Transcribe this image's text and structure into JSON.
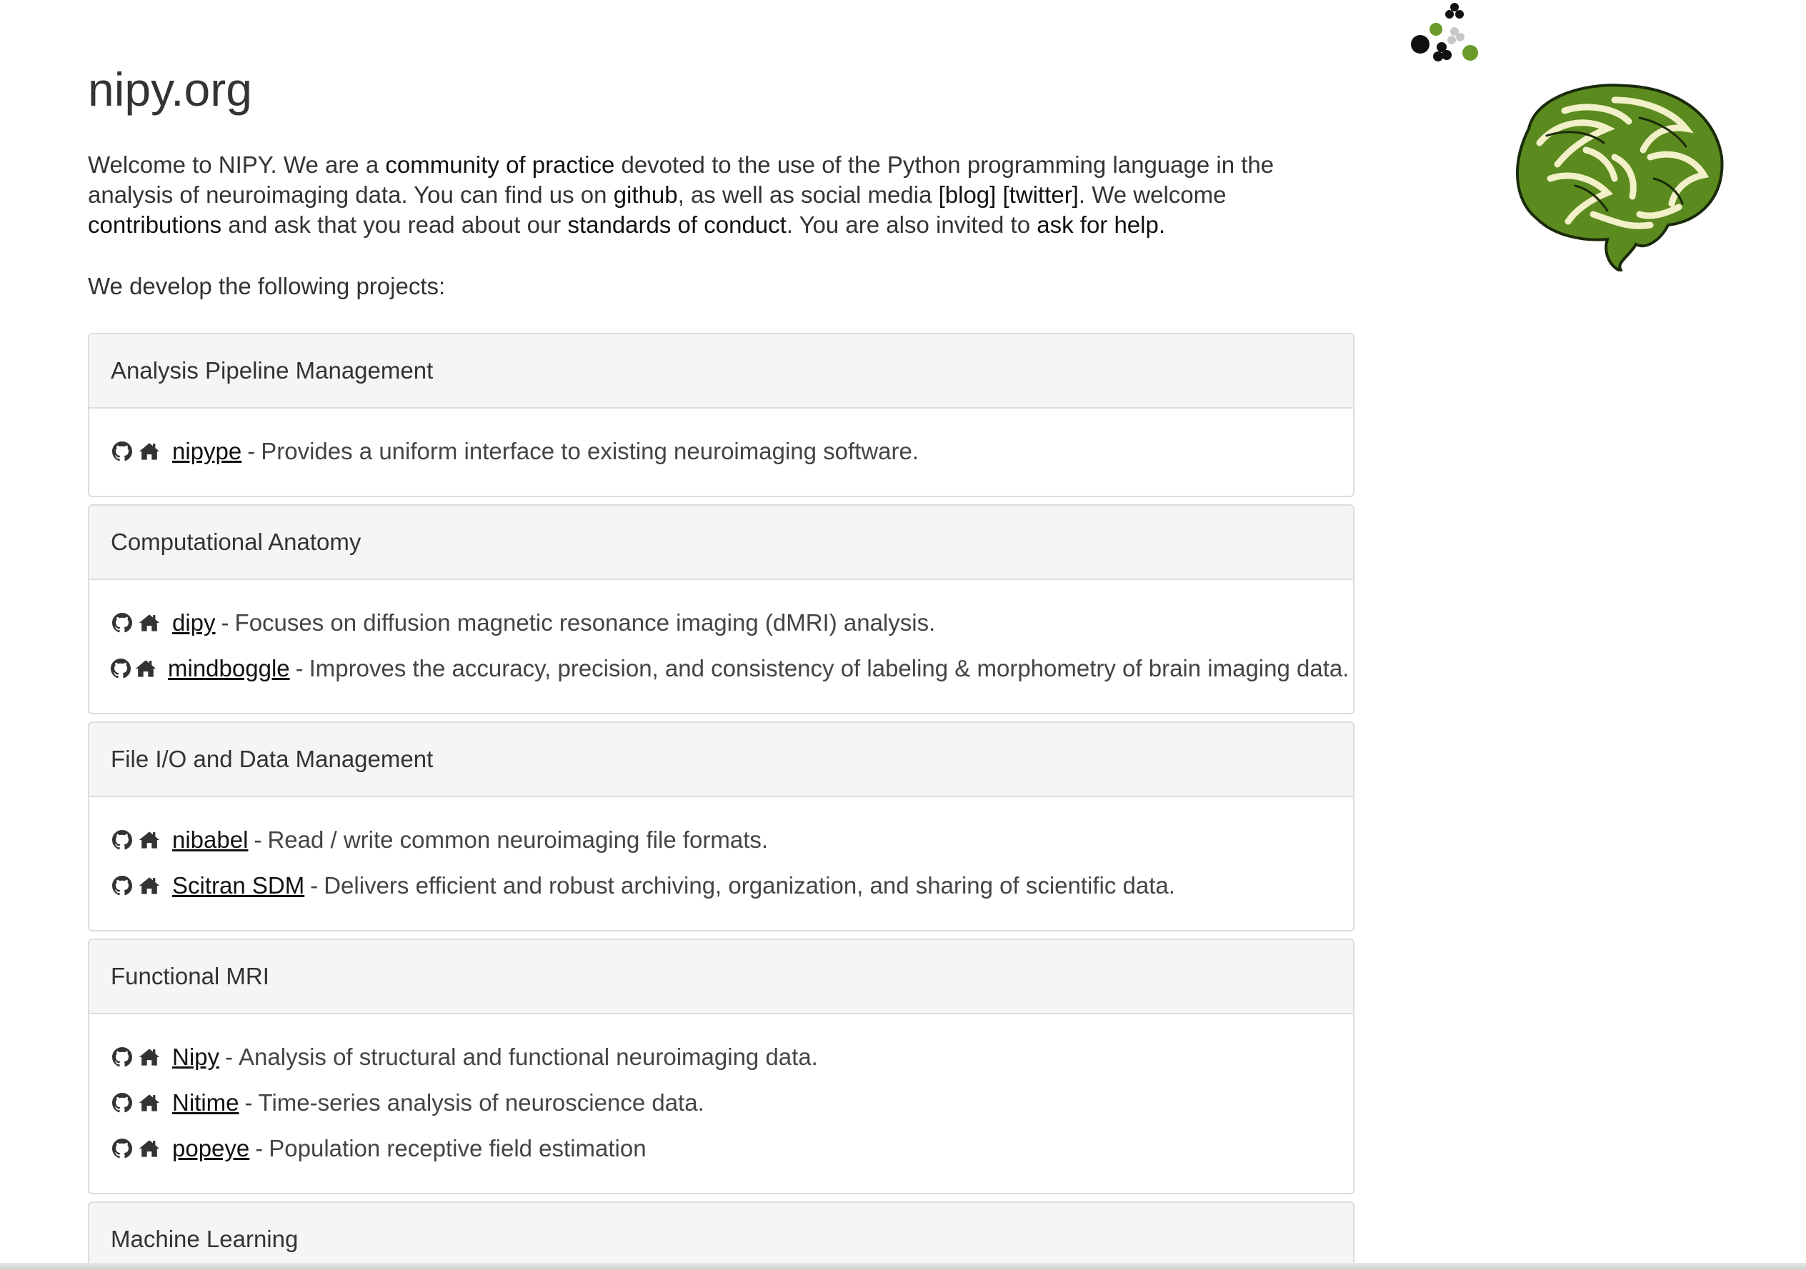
{
  "title": "nipy.org",
  "intro": {
    "t1": "Welcome to NIPY. We are a ",
    "link_community": "community of practice",
    "t2": " devoted to the use of the Python programming language in the analysis of neuroimaging data. You can find us on ",
    "link_github": "github",
    "t3": ", as well as social media ",
    "link_blog": "[blog]",
    "t4": " ",
    "link_twitter": "[twitter]",
    "t5": ". We welcome ",
    "link_contributions": "contributions",
    "t6": " and ask that you read about our ",
    "link_conduct": "standards of conduct",
    "t7": ". You are also invited to ",
    "link_help": "ask for help.",
    "t8": ""
  },
  "projects_lead": "We develop the following projects:",
  "sections": [
    {
      "heading": "Analysis Pipeline Management",
      "projects": [
        {
          "name": "nipype",
          "desc": "Provides a uniform interface to existing neuroimaging software."
        }
      ]
    },
    {
      "heading": "Computational Anatomy",
      "projects": [
        {
          "name": "dipy",
          "desc": "Focuses on diffusion magnetic resonance imaging (dMRI) analysis."
        },
        {
          "name": "mindboggle",
          "desc": "Improves the accuracy, precision, and consistency of labeling & morphometry of brain imaging data."
        }
      ]
    },
    {
      "heading": "File I/O and Data Management",
      "projects": [
        {
          "name": "nibabel",
          "desc": "Read / write common neuroimaging file formats."
        },
        {
          "name": "Scitran SDM",
          "desc": "Delivers efficient and robust archiving, organization, and sharing of scientific data."
        }
      ]
    },
    {
      "heading": "Functional MRI",
      "projects": [
        {
          "name": "Nipy",
          "desc": "Analysis of structural and functional neuroimaging data."
        },
        {
          "name": "Nitime",
          "desc": "Time-series analysis of neuroscience data."
        },
        {
          "name": "popeye",
          "desc": "Population receptive field estimation"
        }
      ]
    },
    {
      "heading": "Machine Learning",
      "projects": []
    }
  ],
  "separator": "-",
  "icons": {
    "github": "github-icon",
    "home": "home-icon",
    "logo": "nipy-dots-logo",
    "brain": "nipy-brain-logo"
  },
  "colors": {
    "logo_green": "#6a9a2a",
    "brain_green": "#5b8a1e",
    "brain_cream": "#f2f0c8"
  }
}
